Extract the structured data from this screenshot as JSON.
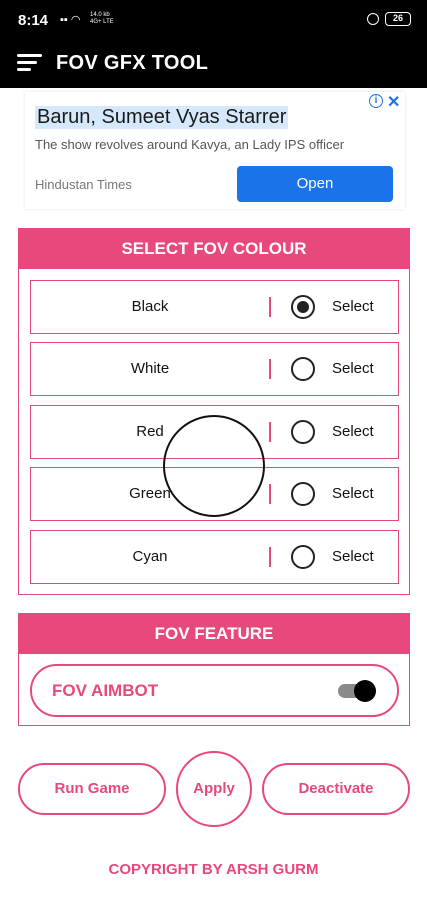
{
  "status_bar": {
    "time": "8:14",
    "net_top": "14.0 kb",
    "net_bottom": "4G+ LTE",
    "battery": "26"
  },
  "app_bar": {
    "title": "FOV GFX TOOL",
    "menu_icon": "menu-icon"
  },
  "ad": {
    "headline": "Barun, Sumeet Vyas Starrer",
    "description": "The show revolves around Kavya, an Lady IPS officer",
    "source": "Hindustan Times",
    "cta": "Open",
    "info_icon": "i",
    "close_icon": "✕",
    "cta_color": "#1a73e8"
  },
  "colour_panel": {
    "title": "SELECT FOV COLOUR",
    "options": [
      {
        "label": "Black",
        "select": "Select",
        "selected": true
      },
      {
        "label": "White",
        "select": "Select",
        "selected": false
      },
      {
        "label": "Red",
        "select": "Select",
        "selected": false
      },
      {
        "label": "Green",
        "select": "Select",
        "selected": false
      },
      {
        "label": "Cyan",
        "select": "Select",
        "selected": false
      }
    ]
  },
  "feature_panel": {
    "title": "FOV FEATURE",
    "item_label": "FOV AIMBOT",
    "toggle_on": true
  },
  "buttons": {
    "run": "Run Game",
    "apply": "Apply",
    "deactivate": "Deactivate"
  },
  "footer": {
    "copyright": "COPYRIGHT BY ARSH GURM"
  },
  "colors": {
    "accent": "#e8497c",
    "bar": "#000000"
  }
}
